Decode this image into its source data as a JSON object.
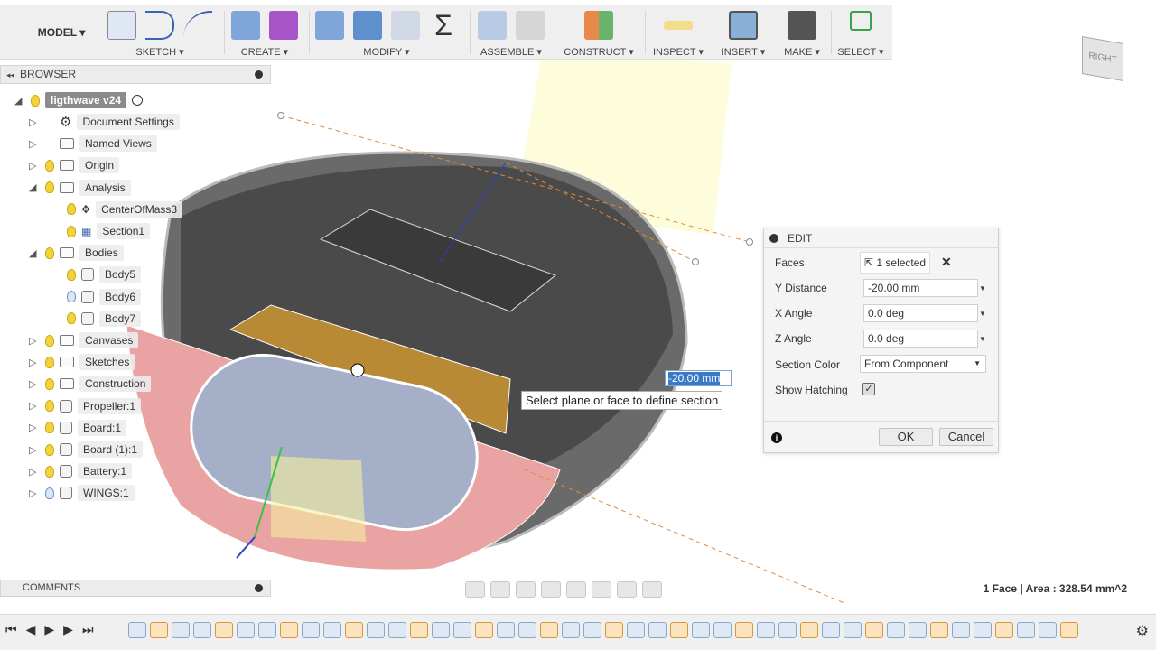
{
  "toolbar": {
    "mode": "MODEL",
    "groups": [
      "SKETCH",
      "CREATE",
      "MODIFY",
      "ASSEMBLE",
      "CONSTRUCT",
      "INSPECT",
      "INSERT",
      "MAKE",
      "SELECT"
    ]
  },
  "browser": {
    "title": "BROWSER",
    "root": "ligthwave v24",
    "items": [
      {
        "label": "Document Settings"
      },
      {
        "label": "Named Views"
      },
      {
        "label": "Origin"
      },
      {
        "label": "Analysis"
      },
      {
        "label": "CenterOfMass3"
      },
      {
        "label": "Section1"
      },
      {
        "label": "Bodies"
      },
      {
        "label": "Body5"
      },
      {
        "label": "Body6"
      },
      {
        "label": "Body7"
      },
      {
        "label": "Canvases"
      },
      {
        "label": "Sketches"
      },
      {
        "label": "Construction"
      },
      {
        "label": "Propeller:1"
      },
      {
        "label": "Board:1"
      },
      {
        "label": "Board (1):1"
      },
      {
        "label": "Battery:1"
      },
      {
        "label": "WINGS:1"
      }
    ]
  },
  "comments": {
    "title": "COMMENTS"
  },
  "edit": {
    "title": "EDIT",
    "faces_label": "Faces",
    "faces_value": "1 selected",
    "y_label": "Y Distance",
    "y_value": "-20.00 mm",
    "x_label": "X Angle",
    "x_value": "0.0 deg",
    "z_label": "Z Angle",
    "z_value": "0.0 deg",
    "color_label": "Section Color",
    "color_value": "From Component",
    "hatch_label": "Show Hatching",
    "hatch_checked": true,
    "ok": "OK",
    "cancel": "Cancel"
  },
  "viewport": {
    "tooltip": "Select plane or face to define section",
    "dim_value": "-20.00 mm",
    "viewcube_face": "RIGHT"
  },
  "status": "1 Face | Area : 328.54 mm^2",
  "colors": {
    "accent": "#3b78c8",
    "hatch": "#e06060",
    "body": "#c8902e"
  }
}
